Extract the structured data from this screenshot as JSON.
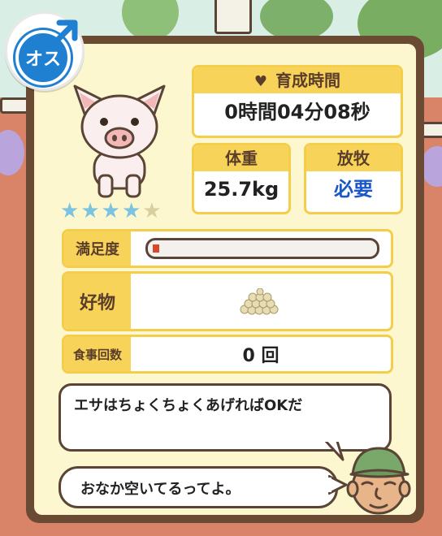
{
  "gender": {
    "label": "オス",
    "icon": "male-symbol-icon",
    "color": "#1f7fd1"
  },
  "pig": {
    "icon": "pig-icon"
  },
  "rating": {
    "filled": 4,
    "total": 5,
    "filled_color": "#7bc3df",
    "empty_color": "#d8cfa0"
  },
  "raising_time": {
    "label": "育成時間",
    "icon": "heart-icon",
    "value": "0時間04分08秒"
  },
  "weight": {
    "label": "体重",
    "value": "25.7kg"
  },
  "grazing": {
    "label": "放牧",
    "value": "必要",
    "value_color": "#1a58c8"
  },
  "satisfaction": {
    "label": "満足度",
    "level": 0.03,
    "fill_color": "#d44a2a"
  },
  "favorite": {
    "label": "好物",
    "icon": "grain-pile-icon"
  },
  "meal_count": {
    "label": "食事回数",
    "value": "0 回"
  },
  "messages": {
    "hint": "エサはちょくちょくあげればOKだ",
    "status": "おなか空いてるってよ。"
  },
  "farmer": {
    "icon": "farmer-face-icon"
  },
  "colors": {
    "panel_border": "#6b4a34",
    "panel_bg": "#fdf7cf",
    "header_bg": "#f8d35a"
  }
}
